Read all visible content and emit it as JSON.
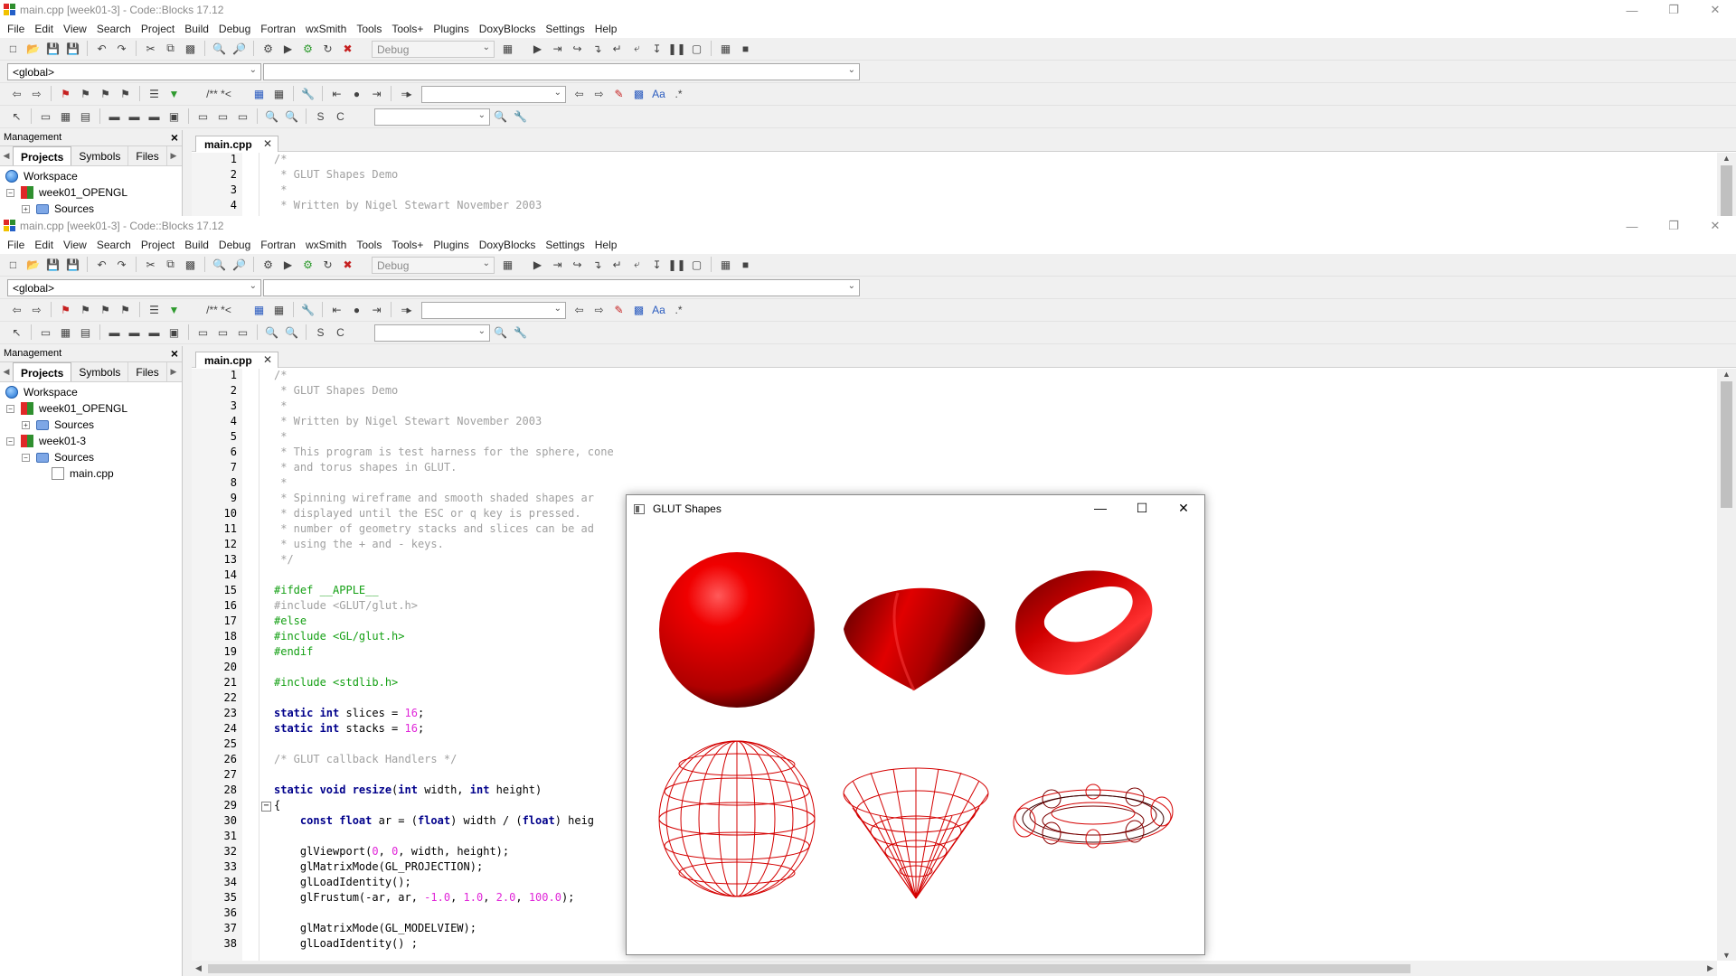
{
  "windows": [
    {
      "title": "main.cpp [week01-3] - Code::Blocks 17.12",
      "code_lines": [
        {
          "n": "1",
          "t": "/*",
          "c": "cmt"
        },
        {
          "n": "2",
          "t": " * GLUT Shapes Demo",
          "c": "cmt"
        },
        {
          "n": "3",
          "t": " *",
          "c": "cmt"
        },
        {
          "n": "4",
          "t": " * Written by Nigel Stewart November 2003",
          "c": "cmt"
        }
      ],
      "tree": [
        {
          "label": "Workspace",
          "icon": "globe"
        },
        {
          "label": "week01_OPENGL",
          "icon": "project"
        },
        {
          "label": "Sources",
          "icon": "folder"
        }
      ]
    },
    {
      "title": "main.cpp [week01-3] - Code::Blocks 17.12",
      "tree": [
        {
          "label": "Workspace",
          "icon": "globe"
        },
        {
          "label": "week01_OPENGL",
          "icon": "project"
        },
        {
          "label": "Sources",
          "icon": "folder"
        },
        {
          "label": "week01-3",
          "icon": "project"
        },
        {
          "label": "Sources",
          "icon": "folder"
        },
        {
          "label": "main.cpp",
          "icon": "file"
        }
      ],
      "code_lines": [
        {
          "n": "1",
          "t": "/*",
          "c": "cmt"
        },
        {
          "n": "2",
          "t": " * GLUT Shapes Demo",
          "c": "cmt"
        },
        {
          "n": "3",
          "t": " *",
          "c": "cmt"
        },
        {
          "n": "4",
          "t": " * Written by Nigel Stewart November 2003",
          "c": "cmt"
        },
        {
          "n": "5",
          "t": " *",
          "c": "cmt"
        },
        {
          "n": "6",
          "t": " * This program is test harness for the sphere, cone",
          "c": "cmt"
        },
        {
          "n": "7",
          "t": " * and torus shapes in GLUT.",
          "c": "cmt"
        },
        {
          "n": "8",
          "t": " *",
          "c": "cmt"
        },
        {
          "n": "9",
          "t": " * Spinning wireframe and smooth shaded shapes ar",
          "c": "cmt"
        },
        {
          "n": "10",
          "t": " * displayed until the ESC or q key is pressed.",
          "c": "cmt"
        },
        {
          "n": "11",
          "t": " * number of geometry stacks and slices can be ad",
          "c": "cmt"
        },
        {
          "n": "12",
          "t": " * using the + and - keys.",
          "c": "cmt"
        },
        {
          "n": "13",
          "t": " */",
          "c": "cmt"
        },
        {
          "n": "14",
          "t": "",
          "c": "plain"
        },
        {
          "n": "15",
          "t": "#ifdef __APPLE__",
          "c": "pre"
        },
        {
          "n": "16",
          "t": "#include <GLUT/glut.h>",
          "c": "cmt"
        },
        {
          "n": "17",
          "t": "#else",
          "c": "pre"
        },
        {
          "n": "18",
          "t": "#include <GL/glut.h>",
          "c": "pre"
        },
        {
          "n": "19",
          "t": "#endif",
          "c": "pre"
        },
        {
          "n": "20",
          "t": "",
          "c": "plain"
        },
        {
          "n": "21",
          "t": "#include <stdlib.h>",
          "c": "pre"
        },
        {
          "n": "22",
          "t": "",
          "c": "plain"
        },
        {
          "n": "23",
          "parts": [
            [
              "static int ",
              "kw"
            ],
            [
              "slices = ",
              "plain"
            ],
            [
              "16",
              "num"
            ],
            [
              ";",
              "plain"
            ]
          ]
        },
        {
          "n": "24",
          "parts": [
            [
              "static int ",
              "kw"
            ],
            [
              "stacks = ",
              "plain"
            ],
            [
              "16",
              "num"
            ],
            [
              ";",
              "plain"
            ]
          ]
        },
        {
          "n": "25",
          "t": "",
          "c": "plain"
        },
        {
          "n": "26",
          "t": "/* GLUT callback Handlers */",
          "c": "cmt"
        },
        {
          "n": "27",
          "t": "",
          "c": "plain"
        },
        {
          "n": "28",
          "parts": [
            [
              "static void resize",
              "kw"
            ],
            [
              "(",
              "plain"
            ],
            [
              "int ",
              "kw"
            ],
            [
              "width, ",
              "plain"
            ],
            [
              "int ",
              "kw"
            ],
            [
              "height)",
              "plain"
            ]
          ]
        },
        {
          "n": "29",
          "t": "{",
          "c": "plain"
        },
        {
          "n": "30",
          "parts": [
            [
              "    const float ",
              "kw"
            ],
            [
              "ar = (",
              "plain"
            ],
            [
              "float",
              "kw"
            ],
            [
              ") width / (",
              "plain"
            ],
            [
              "float",
              "kw"
            ],
            [
              ") heig",
              "plain"
            ]
          ]
        },
        {
          "n": "31",
          "t": "",
          "c": "plain"
        },
        {
          "n": "32",
          "parts": [
            [
              "    glViewport(",
              "plain"
            ],
            [
              "0",
              "num"
            ],
            [
              ", ",
              "plain"
            ],
            [
              "0",
              "num"
            ],
            [
              ", width, height);",
              "plain"
            ]
          ]
        },
        {
          "n": "33",
          "t": "    glMatrixMode(GL_PROJECTION);",
          "c": "plain"
        },
        {
          "n": "34",
          "t": "    glLoadIdentity();",
          "c": "plain"
        },
        {
          "n": "35",
          "parts": [
            [
              "    glFrustum(-ar, ar, ",
              "plain"
            ],
            [
              "-1.0",
              "num"
            ],
            [
              ", ",
              "plain"
            ],
            [
              "1.0",
              "num"
            ],
            [
              ", ",
              "plain"
            ],
            [
              "2.0",
              "num"
            ],
            [
              ", ",
              "plain"
            ],
            [
              "100.0",
              "num"
            ],
            [
              ");",
              "plain"
            ]
          ]
        },
        {
          "n": "36",
          "t": "",
          "c": "plain"
        },
        {
          "n": "37",
          "t": "    glMatrixMode(GL_MODELVIEW);",
          "c": "plain"
        },
        {
          "n": "38",
          "t": "    glLoadIdentity() ;",
          "c": "plain"
        }
      ]
    }
  ],
  "menu": [
    "File",
    "Edit",
    "View",
    "Search",
    "Project",
    "Build",
    "Debug",
    "Fortran",
    "wxSmith",
    "Tools",
    "Tools+",
    "Plugins",
    "DoxyBlocks",
    "Settings",
    "Help"
  ],
  "build_target": "Debug",
  "scope": "<global>",
  "comment_tools": "/** *<",
  "management": {
    "title": "Management",
    "tabs": [
      "Projects",
      "Symbols",
      "Files"
    ]
  },
  "editor_tab": "main.cpp",
  "glut_window": {
    "title": "GLUT Shapes",
    "shapes": [
      {
        "kind": "sphere",
        "style": "solid"
      },
      {
        "kind": "cone",
        "style": "solid"
      },
      {
        "kind": "torus",
        "style": "solid"
      },
      {
        "kind": "sphere",
        "style": "wireframe"
      },
      {
        "kind": "cone",
        "style": "wireframe"
      },
      {
        "kind": "torus",
        "style": "wireframe"
      }
    ],
    "color": "#e00000"
  },
  "colors": {
    "comment": "#a0a0a0",
    "preprocessor": "#14a014",
    "keyword": "#00008b",
    "number": "#e026d8"
  }
}
